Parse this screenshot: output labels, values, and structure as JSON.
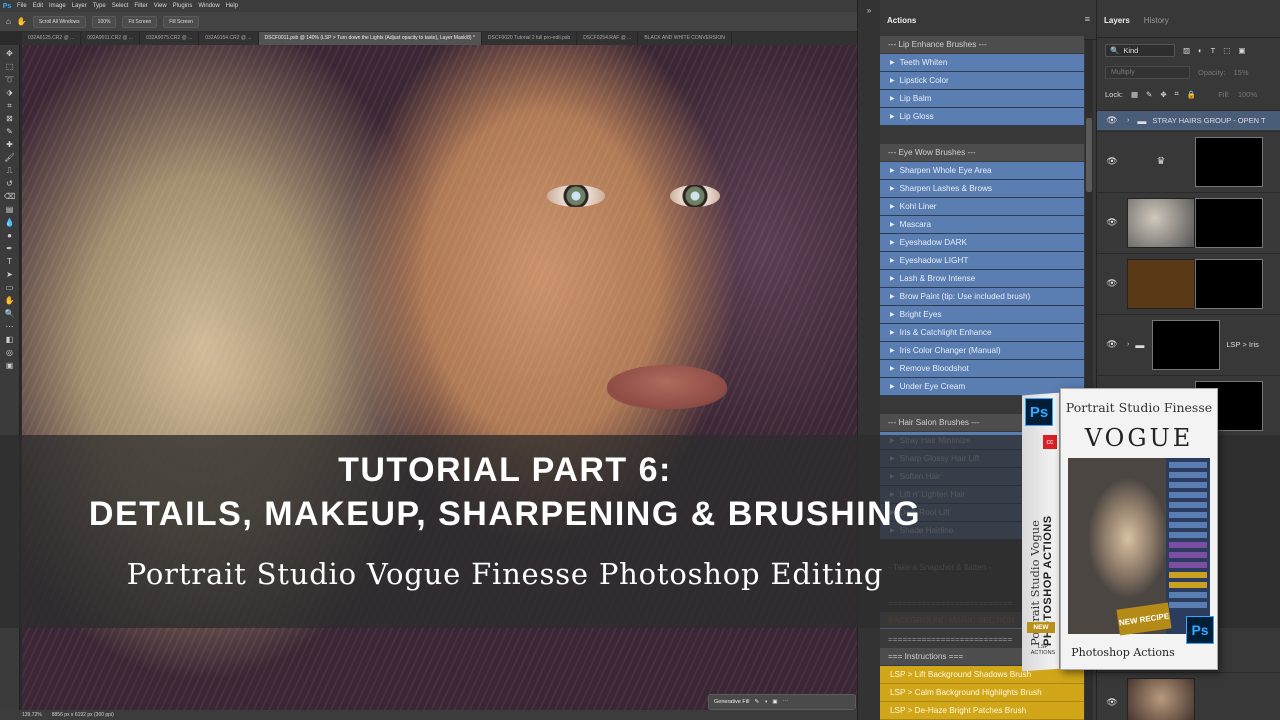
{
  "menubar": {
    "logo": "Ps",
    "items": [
      "File",
      "Edit",
      "Image",
      "Layer",
      "Type",
      "Select",
      "Filter",
      "View",
      "Plugins",
      "Window",
      "Help"
    ]
  },
  "options": {
    "scroll_all": "Scroll All Windows",
    "zoom": "100%",
    "fit_screen": "Fit Screen",
    "fill_screen": "Fill Screen"
  },
  "doc_tabs": [
    {
      "label": "032A6125.CR2 @ ..."
    },
    {
      "label": "092A9011.CR2 @ ..."
    },
    {
      "label": "032A9075.CR2 @ ..."
    },
    {
      "label": "032A9154.CR2 @ ..."
    },
    {
      "label": "DSCF0011.psb @ 140% (LSP > Turn down the Lights (Adjust opacity to taste), Layer Mask/8) *"
    },
    {
      "label": "DSCF0020 Tutorial 2 full pro-edit.psb"
    },
    {
      "label": "DSCF0254.RAF @ ..."
    },
    {
      "label": "BLACK AND WHITE CONVERSION"
    }
  ],
  "status": {
    "zoom": "139.72%",
    "size": "8856 px x 6192 px (300 ppi)"
  },
  "taskbar": {
    "generative_fill": "Generative Fill"
  },
  "actions_panel": {
    "title": "Actions",
    "rows": [
      {
        "type": "set",
        "label": "--- Lip Enhance Brushes ---"
      },
      {
        "type": "act",
        "label": "Teeth Whiten"
      },
      {
        "type": "act",
        "label": "Lipstick Color"
      },
      {
        "type": "act",
        "label": "Lip Balm"
      },
      {
        "type": "act",
        "label": "Lip Gloss"
      },
      {
        "type": "gap",
        "label": ""
      },
      {
        "type": "set",
        "label": "--- Eye Wow Brushes ---"
      },
      {
        "type": "act",
        "label": "Sharpen Whole Eye Area"
      },
      {
        "type": "act",
        "label": "Sharpen Lashes & Brows"
      },
      {
        "type": "act",
        "label": "Kohl Liner"
      },
      {
        "type": "act",
        "label": "Mascara"
      },
      {
        "type": "act",
        "label": "Eyeshadow DARK"
      },
      {
        "type": "act",
        "label": "Eyeshadow LIGHT"
      },
      {
        "type": "act",
        "label": "Lash & Brow Intense"
      },
      {
        "type": "act",
        "label": "Brow Paint (tip: Use included brush)"
      },
      {
        "type": "act",
        "label": "Bright Eyes"
      },
      {
        "type": "act",
        "label": "Iris & Catchlight Enhance"
      },
      {
        "type": "act",
        "label": "Iris Color Changer (Manual)"
      },
      {
        "type": "act",
        "label": "Remove Bloodshot"
      },
      {
        "type": "act",
        "label": "Under Eye Cream"
      },
      {
        "type": "gap",
        "label": ""
      },
      {
        "type": "set",
        "label": "--- Hair Salon Brushes ---"
      },
      {
        "type": "act",
        "label": "Stray Hair Minimize"
      },
      {
        "type": "act",
        "label": "Sharp Glossy Hair Lift"
      },
      {
        "type": "act",
        "label": "Soften Hair"
      },
      {
        "type": "act",
        "label": "Lift n' Lighten Hair"
      },
      {
        "type": "act",
        "label": "Dark Root Lift"
      },
      {
        "type": "act",
        "label": "Shade Hairline"
      },
      {
        "type": "gap",
        "label": ""
      },
      {
        "type": "dimset",
        "label": "- Take a Snapshot & flatten -"
      },
      {
        "type": "gap",
        "label": ""
      },
      {
        "type": "dimset",
        "label": "=========================="
      },
      {
        "type": "red",
        "label": "BACKGROUND MAGIC SECTION"
      },
      {
        "type": "dimset",
        "label": "=========================="
      },
      {
        "type": "yelset",
        "label": "=== Instructions ==="
      },
      {
        "type": "yel",
        "label": "LSP > Lift Background Shadows Brush"
      },
      {
        "type": "yel",
        "label": "LSP > Calm Background Highlights Brush"
      },
      {
        "type": "yel",
        "label": "LSP > De-Haze Bright Patches Brush"
      }
    ]
  },
  "layers_panel": {
    "tabs": [
      "Layers",
      "History"
    ],
    "kind": "Kind",
    "blend": "Multiply",
    "opacity_label": "Opacity:",
    "opacity": "15%",
    "lock_label": "Lock:",
    "fill_label": "Fill:",
    "fill": "100%",
    "group_name": "STRAY HAIRS GROUP - OPEN T",
    "layer_name": "LSP > Iris"
  },
  "banner": {
    "line1": "TUTORIAL PART 6:",
    "line2": "DETAILS, MAKEUP, SHARPENING & BRUSHING",
    "line3": "Portrait Studio Vogue Finesse Photoshop Editing"
  },
  "product_box": {
    "ps": "Ps",
    "adobe": "cc",
    "spine1": "Portrait Studio Vogue",
    "spine2": "PHOTOSHOP ACTIONS",
    "new": "NEW",
    "spine_foot": "LSP ACTIONS",
    "title": "Portrait Studio Finesse",
    "vogue": "VOGUE",
    "recipe": "NEW RECIPE",
    "footer": "Photoshop Actions"
  }
}
